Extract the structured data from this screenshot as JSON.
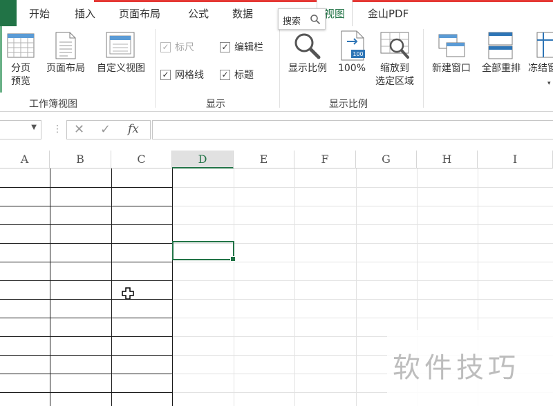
{
  "tabs": {
    "home": "开始",
    "insert": "插入",
    "page_layout": "页面布局",
    "formulas": "公式",
    "data": "数据",
    "view": "视图",
    "wps_pdf": "金山PDF"
  },
  "search_popup": {
    "label": "搜索"
  },
  "ribbon": {
    "workbook_views": {
      "group_label": "工作簿视图",
      "page_break_preview": "分页\n预览",
      "page_layout": "页面布局",
      "custom_views": "自定义视图"
    },
    "show": {
      "group_label": "显示",
      "ruler": {
        "label": "标尺",
        "checked": true,
        "enabled": false
      },
      "formula_bar": {
        "label": "编辑栏",
        "checked": true,
        "enabled": true
      },
      "gridlines": {
        "label": "网格线",
        "checked": true,
        "enabled": true
      },
      "headings": {
        "label": "标题",
        "checked": true,
        "enabled": true
      }
    },
    "zoom": {
      "group_label": "显示比例",
      "zoom": "显示比例",
      "zoom_100": "100%",
      "zoom_to_selection": "缩放到\n选定区域"
    },
    "window": {
      "new_window": "新建窗口",
      "arrange_all": "全部重排",
      "freeze_panes": "冻结窗"
    }
  },
  "formula_bar": {
    "name_box": "",
    "cancel_icon": "✕",
    "enter_icon": "✓",
    "fx_label": "fx",
    "value": ""
  },
  "columns": [
    "A",
    "B",
    "C",
    "D",
    "E",
    "F",
    "G",
    "H",
    "I"
  ],
  "selected_column": "D",
  "watermark": "软件技巧",
  "colors": {
    "accent": "#217346",
    "red_accent": "#e53935"
  }
}
